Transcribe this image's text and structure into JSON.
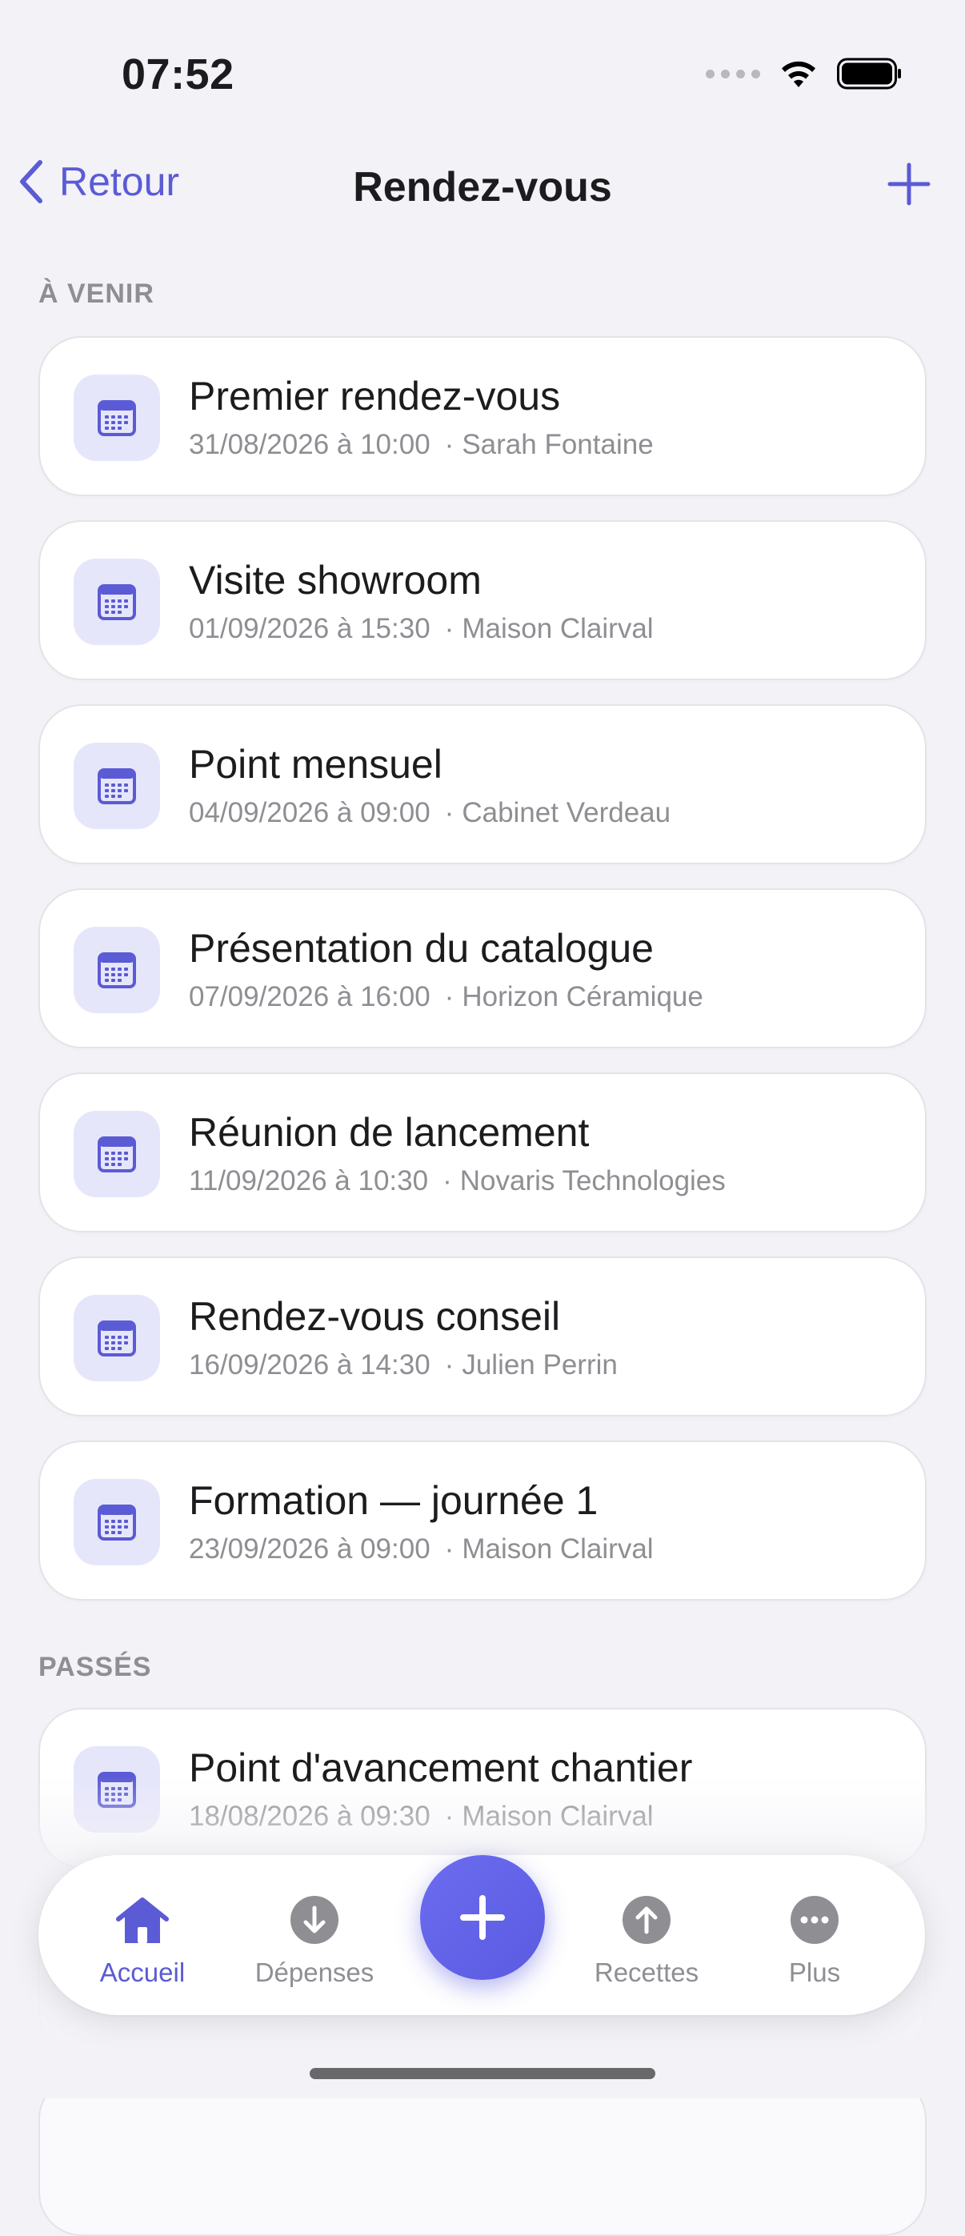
{
  "status_bar": {
    "time": "07:52"
  },
  "nav": {
    "back_label": "Retour",
    "title": "Rendez-vous"
  },
  "sections": {
    "upcoming_header": "À VENIR",
    "past_header": "PASSÉS"
  },
  "upcoming": [
    {
      "title": "Premier rendez-vous",
      "datetime": "31/08/2026 à 10:00",
      "contact": "Sarah Fontaine"
    },
    {
      "title": "Visite showroom",
      "datetime": "01/09/2026 à 15:30",
      "contact": "Maison Clairval"
    },
    {
      "title": "Point mensuel",
      "datetime": "04/09/2026 à 09:00",
      "contact": "Cabinet Verdeau"
    },
    {
      "title": "Présentation du catalogue",
      "datetime": "07/09/2026 à 16:00",
      "contact": "Horizon Céramique"
    },
    {
      "title": "Réunion de lancement",
      "datetime": "11/09/2026 à 10:30",
      "contact": "Novaris Technologies"
    },
    {
      "title": "Rendez-vous conseil",
      "datetime": "16/09/2026 à 14:30",
      "contact": "Julien Perrin"
    },
    {
      "title": "Formation — journée 1",
      "datetime": "23/09/2026 à 09:00",
      "contact": "Maison Clairval"
    }
  ],
  "past": [
    {
      "title": "Point d'avancement chantier",
      "datetime": "18/08/2026 à 09:30",
      "contact": "Maison Clairval"
    }
  ],
  "separator": "·",
  "tabbar": {
    "tabs": [
      {
        "label": "Accueil",
        "icon": "house-icon",
        "active": true
      },
      {
        "label": "Dépenses",
        "icon": "arrow-down-circle-icon",
        "active": false
      },
      {
        "label": "Recettes",
        "icon": "arrow-up-circle-icon",
        "active": false
      },
      {
        "label": "Plus",
        "icon": "ellipsis-circle-icon",
        "active": false
      }
    ]
  },
  "colors": {
    "accent": "#5b5bd6",
    "background": "#f2f2f7",
    "secondary_text": "#8e8e93",
    "icon_bg": "#e6e6fb"
  }
}
